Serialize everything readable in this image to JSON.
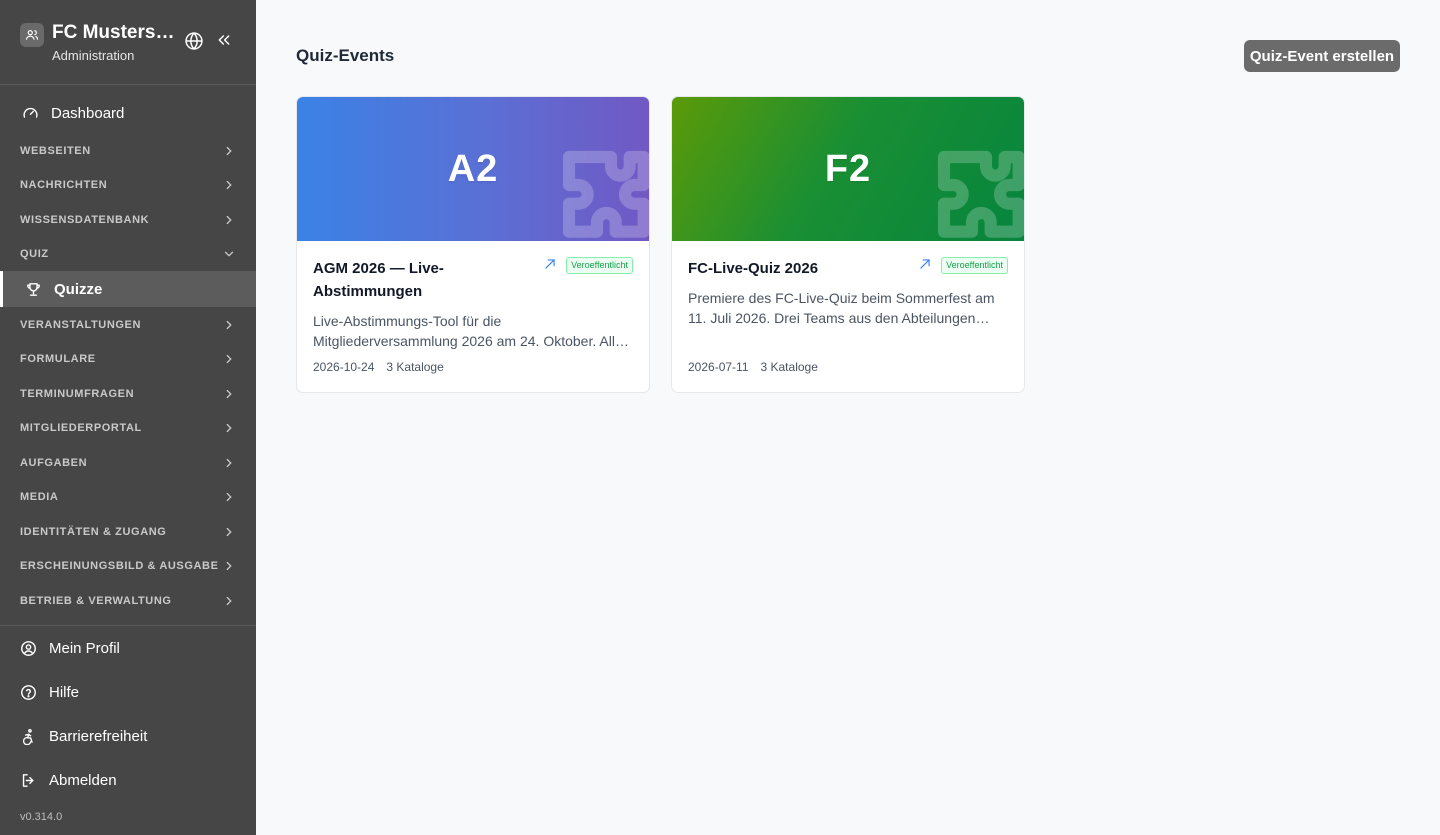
{
  "brand": {
    "title": "FC Musterstadt",
    "subtitle": "Administration"
  },
  "nav": {
    "dashboard": "Dashboard",
    "sections": [
      "WEBSEITEN",
      "NACHRICHTEN",
      "WISSENSDATENBANK",
      "QUIZ",
      "VERANSTALTUNGEN",
      "FORMULARE",
      "TERMINUMFRAGEN",
      "MITGLIEDERPORTAL",
      "AUFGABEN",
      "MEDIA",
      "IDENTITÄTEN & ZUGANG",
      "ERSCHEINUNGSBILD & AUSGABE",
      "BETRIEB & VERWALTUNG"
    ],
    "active_item": "Quizze",
    "bottom": [
      "Mein Profil",
      "Hilfe",
      "Barrierefreiheit",
      "Abmelden"
    ],
    "version": "v0.314.0"
  },
  "main": {
    "title": "Quiz-Events",
    "create_button": "Quiz-Event erstellen",
    "cards": [
      {
        "code": "A2",
        "title": "AGM 2026 — Live-Abstimmungen",
        "status": "Veroeffentlicht",
        "description": "Live-Abstimmungs-Tool für die Mitgliederversammlung 2026 am 24. Oktober. Alle Abstimmungen und Wahlen.",
        "date": "2026-10-24",
        "catalogs": "3 Kataloge",
        "gradient": [
          "#3b82e6",
          "#7258c4"
        ]
      },
      {
        "code": "F2",
        "title": "FC-Live-Quiz 2026",
        "status": "Veroeffentlicht",
        "description": "Premiere des FC-Live-Quiz beim Sommerfest am 11. Juli 2026. Drei Teams aus den Abteilungen treten gegeneinander an.",
        "date": "2026-07-11",
        "catalogs": "3 Kataloge",
        "gradient": [
          "#5c9a08",
          "#06853f"
        ]
      }
    ]
  },
  "colors": {
    "sidebar_bg": "#464646",
    "active_bg": "#5c5c5c",
    "button_bg": "#6b6b6b",
    "badge_green": "#16a34a"
  }
}
